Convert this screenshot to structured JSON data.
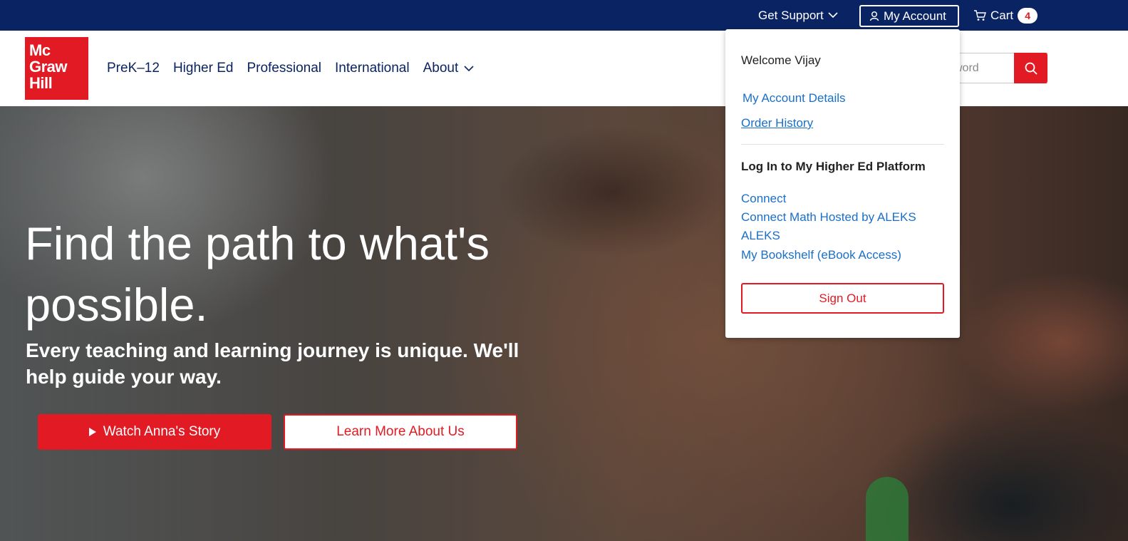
{
  "topbar": {
    "get_support_label": "Get Support",
    "my_account_label": "My Account",
    "cart_label": "Cart",
    "cart_count": "4"
  },
  "header": {
    "logo_lines": [
      "Mc",
      "Graw",
      "Hill"
    ],
    "nav": [
      {
        "label": "PreK–12"
      },
      {
        "label": "Higher Ed"
      },
      {
        "label": "Professional"
      },
      {
        "label": "International"
      },
      {
        "label": "About"
      }
    ],
    "search_placeholder": "word"
  },
  "hero": {
    "title": "Find the path to what's possible.",
    "subtitle": "Every teaching and learning journey is unique. We'll help guide your way.",
    "watch_button": "Watch Anna's Story",
    "learn_button": "Learn More About Us"
  },
  "account_menu": {
    "welcome": "Welcome Vijay",
    "account_details": "My Account Details",
    "order_history": "Order History",
    "platform_heading": "Log In to My Higher Ed Platform",
    "platforms": [
      {
        "label": "Connect"
      },
      {
        "label": "Connect Math Hosted by ALEKS"
      },
      {
        "label": "ALEKS"
      },
      {
        "label": "My Bookshelf (eBook Access)"
      }
    ],
    "sign_out": "Sign Out"
  },
  "colors": {
    "navy": "#0a2463",
    "brand_red": "#e21a23",
    "link_blue": "#1a6fc9"
  }
}
